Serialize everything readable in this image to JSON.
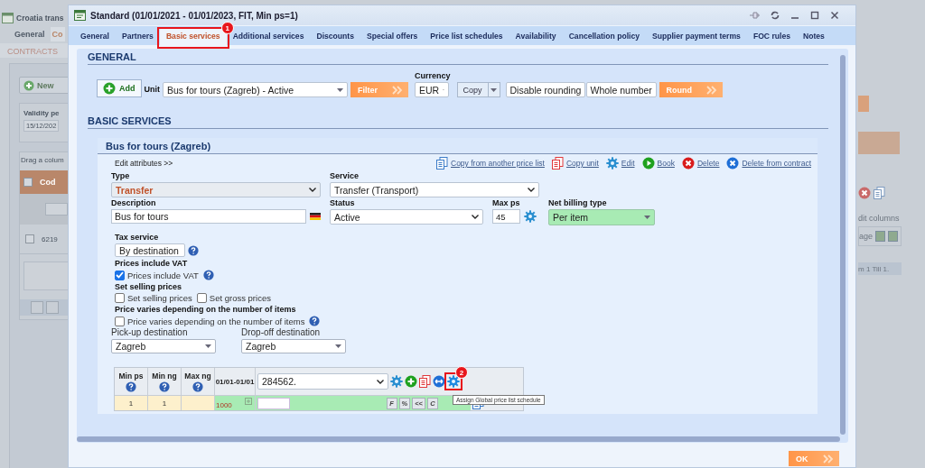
{
  "background": {
    "title": "Croatia trans",
    "tabs": [
      {
        "label": "General",
        "selected": false
      },
      {
        "label": "Co",
        "selected": true
      }
    ],
    "subtab": "CONTRACTS",
    "new_button": "New",
    "validity_label": "Validity pe",
    "validity_value": "15/12/202",
    "group_hint": "Drag a colum",
    "grid_column": "Cod",
    "header_checkbox": {
      "checked": false
    },
    "row_checkbox": {
      "checked": false
    },
    "grid_cell": "6219",
    "edit_columns": "dit columns",
    "page_label": "age",
    "pager_info": "m 1 Till 1."
  },
  "window": {
    "title": "Standard (01/01/2021 - 01/01/2023, FIT, Min ps=1)"
  },
  "tabs": [
    {
      "label": "General",
      "selected": false
    },
    {
      "label": "Partners",
      "selected": false
    },
    {
      "label": "Basic services",
      "selected": true,
      "callout": "1"
    },
    {
      "label": "Additional services",
      "selected": false
    },
    {
      "label": "Discounts",
      "selected": false
    },
    {
      "label": "Special offers",
      "selected": false
    },
    {
      "label": "Price list schedules",
      "selected": false
    },
    {
      "label": "Availability",
      "selected": false
    },
    {
      "label": "Cancellation policy",
      "selected": false
    },
    {
      "label": "Supplier payment terms",
      "selected": false
    },
    {
      "label": "FOC rules",
      "selected": false
    },
    {
      "label": "Notes",
      "selected": false
    }
  ],
  "general": {
    "heading": "GENERAL",
    "add_button": "Add",
    "unit_label": "Unit",
    "unit_value": "Bus for tours (Zagreb)  - Active",
    "filter_button": "Filter",
    "currency_label": "Currency",
    "currency_value": "EUR",
    "copy_button": "Copy",
    "rounding_value": "Disable rounding",
    "rounding_unit_value": "Whole number",
    "round_button": "Round"
  },
  "basic_services": {
    "heading": "BASIC SERVICES",
    "unit_title": "Bus for tours (Zagreb)",
    "edit_attributes_link": "Edit attributes >>",
    "actions": [
      {
        "kind": "copy_list",
        "label": "Copy from another price list"
      },
      {
        "kind": "copy_unit",
        "label": "Copy unit"
      },
      {
        "kind": "edit",
        "label": "Edit"
      },
      {
        "kind": "book",
        "label": "Book"
      },
      {
        "kind": "delete",
        "label": "Delete"
      },
      {
        "kind": "delete_contract",
        "label": "Delete from contract"
      }
    ],
    "type": {
      "label": "Type",
      "value": "Transfer",
      "disabled": true
    },
    "service": {
      "label": "Service",
      "value": "Transfer (Transport)"
    },
    "description": {
      "label": "Description",
      "value": "Bus for tours"
    },
    "status": {
      "label": "Status",
      "value": "Active"
    },
    "max_ps": {
      "label": "Max ps",
      "value": "45"
    },
    "net_billing_type": {
      "label": "Net billing type",
      "value": "Per item"
    },
    "tax_service": {
      "label": "Tax service",
      "value": "By destination"
    },
    "options": [
      {
        "heading": "Prices include VAT",
        "checkboxes": [
          {
            "label": "Prices include VAT",
            "checked": true,
            "help": true
          }
        ]
      },
      {
        "heading": "Set selling prices",
        "checkboxes": [
          {
            "label": "Set selling prices",
            "checked": false,
            "help": false
          },
          {
            "label": "Set gross prices",
            "checked": false,
            "help": false
          }
        ]
      },
      {
        "heading": "Price varies depending on the number of items",
        "checkboxes": [
          {
            "label": "Price varies depending on the number of items",
            "checked": false,
            "help": true
          }
        ]
      }
    ],
    "pickup": {
      "label": "Pick-up destination",
      "value": "Zagreb"
    },
    "dropoff": {
      "label": "Drop-off destination",
      "value": "Zagreb"
    },
    "price_table": {
      "columns": [
        {
          "label": "Min ps"
        },
        {
          "label": "Min ng"
        },
        {
          "label": "Max ng"
        }
      ],
      "period": "01/01-01/01",
      "schedule_value": "284562.",
      "tools": [
        {
          "kind": "settings"
        },
        {
          "kind": "add"
        },
        {
          "kind": "copy"
        },
        {
          "kind": "swap"
        },
        {
          "kind": "global",
          "callout": "2"
        }
      ],
      "tooltip": "Assign Global price list schedule",
      "row": {
        "min_ps": "1",
        "min_ng": "1",
        "price": "1000"
      },
      "row_buttons": [
        "F",
        "%",
        "<<",
        "C"
      ]
    }
  },
  "ok_button": "OK"
}
